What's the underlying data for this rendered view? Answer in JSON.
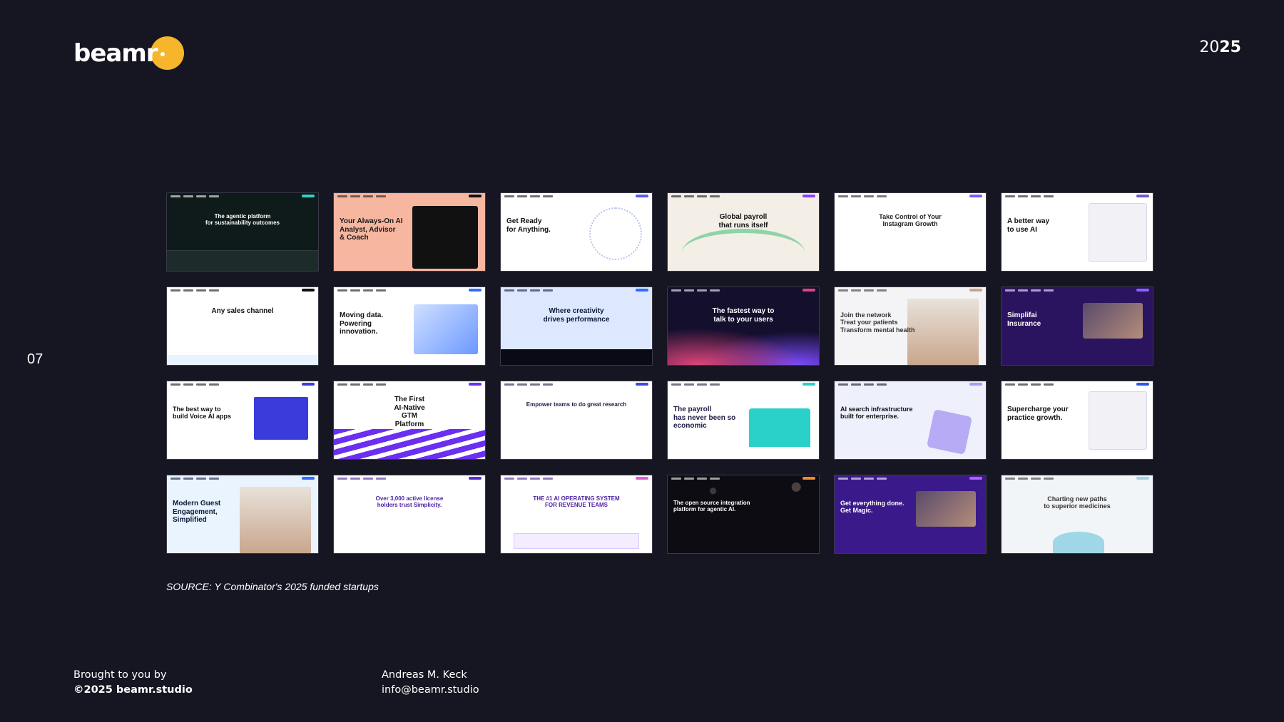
{
  "brand": {
    "logo_text": "beamr",
    "year_prefix": "20",
    "year_suffix": "25"
  },
  "page_number": "07",
  "source": "SOURCE: Y Combinator's 2025 funded startups",
  "footer": {
    "left_line1": "Brought to you by",
    "left_line2": "©2025 beamr.studio",
    "right_line1": "Andreas M. Keck",
    "right_line2": "info@beamr.studio"
  },
  "screenshots": [
    {
      "headline": "The agentic platform\nfor sustainability outcomes",
      "bg": "#0f1a1a",
      "fg": "#ffffff",
      "accent": "#2fd3c9",
      "align": "center",
      "art": "panel-dark"
    },
    {
      "headline": "Your Always-On AI\nAnalyst, Advisor\n& Coach",
      "bg": "#f6b6a0",
      "fg": "#1a1a1a",
      "accent": "#111111",
      "align": "left",
      "art": "dark-card"
    },
    {
      "headline": "Get Ready\nfor Anything.",
      "bg": "#ffffff",
      "fg": "#111111",
      "accent": "#5b5bf5",
      "align": "left",
      "art": "nodes"
    },
    {
      "headline": "Global payroll\nthat runs itself",
      "bg": "#f3efe7",
      "fg": "#111111",
      "accent": "#8b3dff",
      "align": "center",
      "art": "arc"
    },
    {
      "headline": "Take Control of Your\nInstagram Growth",
      "bg": "#ffffff",
      "fg": "#222222",
      "accent": "#7a5cff",
      "align": "center",
      "art": "none"
    },
    {
      "headline": "A better way\nto use AI",
      "bg": "#ffffff",
      "fg": "#111111",
      "accent": "#6b5bd6",
      "align": "left",
      "art": "ui-panel"
    },
    {
      "headline": "Any sales channel",
      "bg": "#ffffff",
      "fg": "#111111",
      "accent": "#111111",
      "align": "center",
      "art": "strip"
    },
    {
      "headline": "Moving data.\nPowering\ninnovation.",
      "bg": "#ffffff",
      "fg": "#111111",
      "accent": "#2f6bff",
      "align": "left",
      "art": "plane"
    },
    {
      "headline": "Where creativity\ndrives performance",
      "bg": "#dde8ff",
      "fg": "#0b1a3a",
      "accent": "#2f6bff",
      "align": "center",
      "art": "gradient-blue"
    },
    {
      "headline": "The fastest way to\ntalk to your users",
      "bg": "#150f2e",
      "fg": "#ffffff",
      "accent": "#e0457b",
      "align": "center",
      "art": "glow-pink"
    },
    {
      "headline": "Join the network\nTreat your patients\nTransform mental health",
      "bg": "#f4f4f6",
      "fg": "#333333",
      "accent": "#c9a58c",
      "align": "left",
      "art": "photo-light"
    },
    {
      "headline": "Simplifai\nInsurance",
      "bg": "#2a1460",
      "fg": "#ffffff",
      "accent": "#8a63ff",
      "align": "left",
      "art": "photo-dark"
    },
    {
      "headline": "The best way to\nbuild Voice AI apps",
      "bg": "#ffffff",
      "fg": "#111111",
      "accent": "#3b3bdb",
      "align": "left",
      "art": "map"
    },
    {
      "headline": "The First\nAI-Native\nGTM\nPlatform",
      "bg": "#ffffff",
      "fg": "#111111",
      "accent": "#6a2ff0",
      "align": "center",
      "art": "stripes-purple"
    },
    {
      "headline": "Empower teams to do great research",
      "bg": "#ffffff",
      "fg": "#1a1a40",
      "accent": "#3b49df",
      "align": "center",
      "art": "none"
    },
    {
      "headline": "The payroll\nhas never been so\neconomic",
      "bg": "#ffffff",
      "fg": "#1a1a40",
      "accent": "#2ad1c8",
      "align": "left",
      "art": "laptop"
    },
    {
      "headline": "AI search infrastructure\nbuilt for enterprise.",
      "bg": "#eef0fb",
      "fg": "#111111",
      "accent": "#a99af5",
      "align": "left",
      "art": "cube"
    },
    {
      "headline": "Supercharge your\npractice growth.",
      "bg": "#ffffff",
      "fg": "#111111",
      "accent": "#2a56f0",
      "align": "left",
      "art": "ui-panel"
    },
    {
      "headline": "Modern Guest\nEngagement,\nSimplified",
      "bg": "#eaf4ff",
      "fg": "#0b1a3a",
      "accent": "#2f6bff",
      "align": "left",
      "art": "photo-light"
    },
    {
      "headline": "Over 3,000 active license\nholders trust Simplicity.",
      "bg": "#ffffff",
      "fg": "#4a1fa0",
      "accent": "#5b2bd6",
      "align": "center",
      "art": "none"
    },
    {
      "headline": "THE #1 AI OPERATING SYSTEM\nFOR REVENUE TEAMS",
      "bg": "#ffffff",
      "fg": "#4a1fa0",
      "accent": "#e35ad8",
      "align": "center",
      "art": "stats"
    },
    {
      "headline": "The open source integration\nplatform for agentic AI.",
      "bg": "#0c0c12",
      "fg": "#ffffff",
      "accent": "#f08a35",
      "align": "left",
      "art": "stars"
    },
    {
      "headline": "Get everything done.\nGet Magic.",
      "bg": "#3a1a8a",
      "fg": "#ffffff",
      "accent": "#b35cff",
      "align": "left",
      "art": "photo-dark"
    },
    {
      "headline": "Charting new paths\nto superior medicines",
      "bg": "#f2f5f8",
      "fg": "#333333",
      "accent": "#9fd7e6",
      "align": "center",
      "art": "cluster"
    }
  ]
}
